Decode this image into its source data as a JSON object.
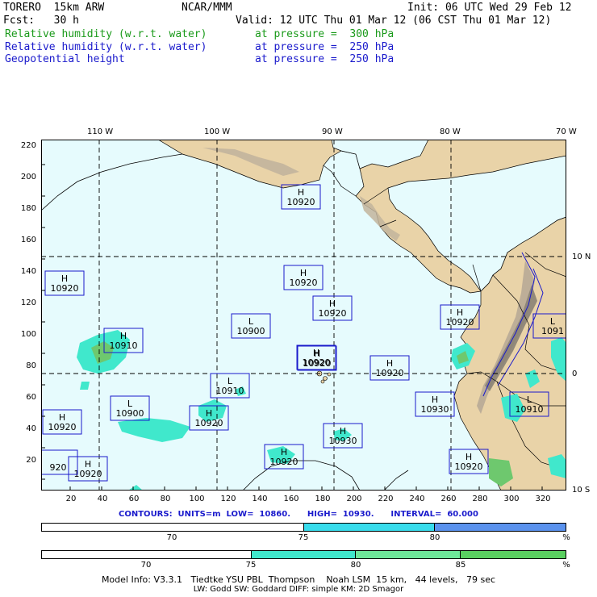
{
  "header": {
    "model": "TORERO  15km ARW",
    "center": "NCAR/MMM",
    "init": "Init: 06 UTC Wed 29 Feb 12",
    "fcst": "Fcst:   30 h",
    "valid": "Valid: 12 UTC Thu 01 Mar 12 (06 CST Thu 01 Mar 12)",
    "fields": [
      {
        "name": "Relative humidity (w.r.t. water)",
        "level": "at pressure =  300 hPa",
        "color": "#1a9a1a"
      },
      {
        "name": "Relative humidity (w.r.t. water)",
        "level": "at pressure =  250 hPa",
        "color": "#1a1acc"
      },
      {
        "name": "Geopotential height",
        "level": "at pressure =  250 hPa",
        "color": "#1a1acc"
      }
    ]
  },
  "map": {
    "ocean_color": "#e6fbfd",
    "land_color": "#e9d3a8",
    "lon_labels": [
      "110 W",
      "100 W",
      "90 W",
      "80 W",
      "70 W"
    ],
    "lat_labels": [
      "10 N",
      "0",
      "10 S"
    ],
    "y_ticks": [
      "220",
      "200",
      "180",
      "160",
      "140",
      "120",
      "100",
      "80",
      "60",
      "40",
      "20"
    ],
    "x_ticks": [
      "20",
      "40",
      "60",
      "80",
      "100",
      "120",
      "140",
      "160",
      "180",
      "200",
      "220",
      "240",
      "260",
      "280",
      "300",
      "320"
    ],
    "centers": [
      {
        "type": "H",
        "value": "10920"
      },
      {
        "type": "H",
        "value": "10920"
      },
      {
        "type": "H",
        "value": "10920"
      },
      {
        "type": "H",
        "value": "10920"
      },
      {
        "type": "H",
        "value": "10920"
      },
      {
        "type": "L",
        "value": "10900"
      },
      {
        "type": "H",
        "value": "10920"
      },
      {
        "type": "H",
        "value": "10920"
      },
      {
        "type": "L",
        "value": "10910"
      },
      {
        "type": "H",
        "value": "10910"
      },
      {
        "type": "L",
        "value": "10900"
      },
      {
        "type": "H",
        "value": "10920"
      },
      {
        "type": "H",
        "value": "10930"
      },
      {
        "type": "L",
        "value": "10910"
      },
      {
        "type": "H",
        "value": "10930"
      },
      {
        "type": "H",
        "value": "10920"
      },
      {
        "type": "H",
        "value": "10920"
      },
      {
        "type": "H",
        "value": "10920"
      },
      {
        "type": "L",
        "value": "1091"
      },
      {
        "type": "H",
        "value": "10920"
      },
      {
        "type": "",
        "value": "920"
      },
      {
        "type": "H",
        "value": "10920"
      }
    ]
  },
  "contours": {
    "text": "CONTOURS:  UNITS=m  LOW=  10860.      HIGH=  10930.      INTERVAL=  60.000",
    "color": "#1a1acc"
  },
  "colorbar_250": {
    "segments": [
      {
        "color": "#ffffff",
        "fraction": 0.5
      },
      {
        "color": "#38dcec",
        "fraction": 0.25
      },
      {
        "color": "#5a92ee",
        "fraction": 0.25
      }
    ],
    "ticks": [
      "70",
      "75",
      "80"
    ],
    "unit": "%"
  },
  "colorbar_300": {
    "segments": [
      {
        "color": "#ffffff",
        "fraction": 0.4
      },
      {
        "color": "#40e8cc",
        "fraction": 0.2
      },
      {
        "color": "#6ee89a",
        "fraction": 0.2
      },
      {
        "color": "#5ad060",
        "fraction": 0.2
      }
    ],
    "ticks": [
      "70",
      "75",
      "80",
      "85"
    ],
    "unit": "%"
  },
  "model_info": {
    "line1": "Model Info: V3.3.1   Tiedtke YSU PBL  Thompson    Noah LSM  15 km,   44 levels,   79 sec",
    "line2": "LW: Godd SW: Goddard DIFF: simple KM: 2D Smagor"
  }
}
